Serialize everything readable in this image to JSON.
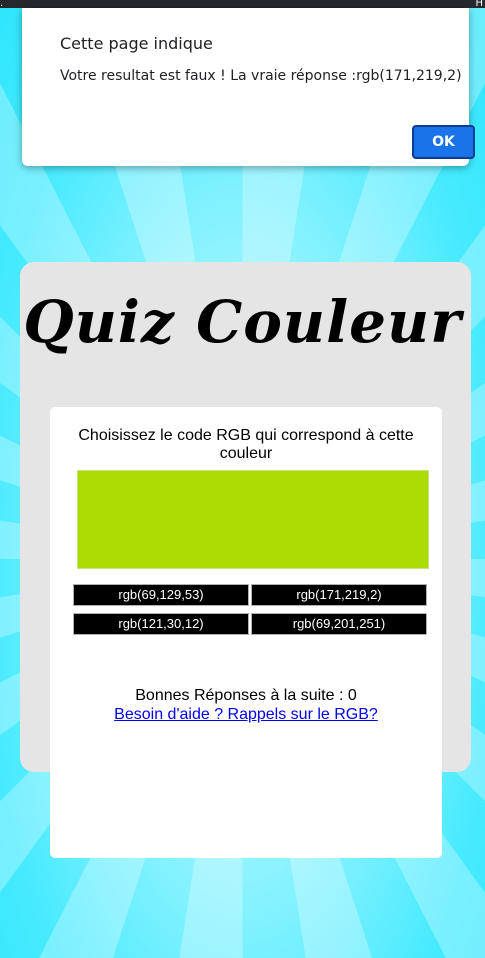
{
  "browser": {
    "left_glyph": ".",
    "right_glyph": "H"
  },
  "dialog": {
    "title": "Cette page indique",
    "message": "Votre resultat est faux ! La vraie réponse :rgb(171,219,2)",
    "ok_label": "OK"
  },
  "quiz": {
    "title": "Quiz Couleur",
    "question": "Choisissez le code RGB qui correspond à cette couleur",
    "target_color": "rgb(171,219,2)",
    "answers": [
      "rgb(69,129,53)",
      "rgb(171,219,2)",
      "rgb(121,30,12)",
      "rgb(69,201,251)"
    ],
    "score_text": "Bonnes Réponses à la suite : 0",
    "help_link": "Besoin d'aide ? Rappels sur le RGB?"
  },
  "colors": {
    "page_background": "#47eaff",
    "card_background": "#e5e5e5",
    "panel_background": "#ffffff",
    "answer_button": "#000000",
    "ok_button": "#1a73e8",
    "link": "#0000ee"
  }
}
